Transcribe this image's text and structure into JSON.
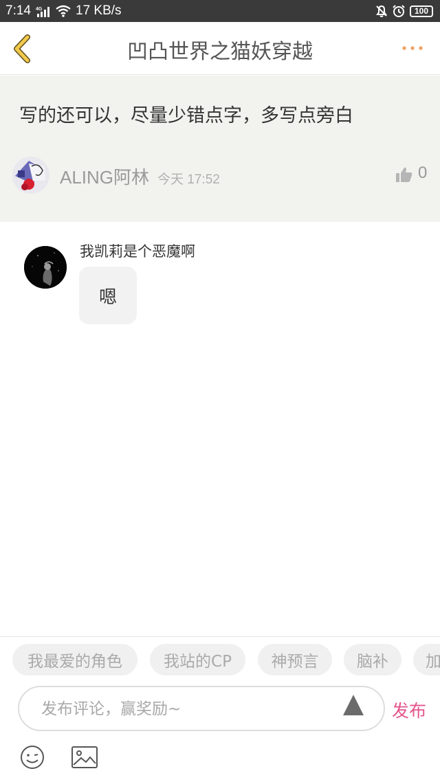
{
  "status_bar": {
    "time": "7:14",
    "network_type": "4G",
    "speed": "17 KB/s",
    "battery": "100"
  },
  "nav": {
    "title": "凹凸世界之猫妖穿越"
  },
  "original_comment": {
    "text": "写的还可以，尽量少错点字，多写点旁白",
    "username": "ALING阿林",
    "time": "今天 17:52",
    "likes": "0"
  },
  "reply": {
    "username": "我凯莉是个恶魔啊",
    "text": "嗯"
  },
  "tags": [
    "我最爱的角色",
    "我站的CP",
    "神预言",
    "脑补",
    "加"
  ],
  "composer": {
    "placeholder": "发布评论，赢奖励~",
    "publish_label": "发布"
  },
  "colors": {
    "accent_pink": "#e5548b",
    "back_arrow": "#f2c94c",
    "more_dots": "#f0a060"
  }
}
